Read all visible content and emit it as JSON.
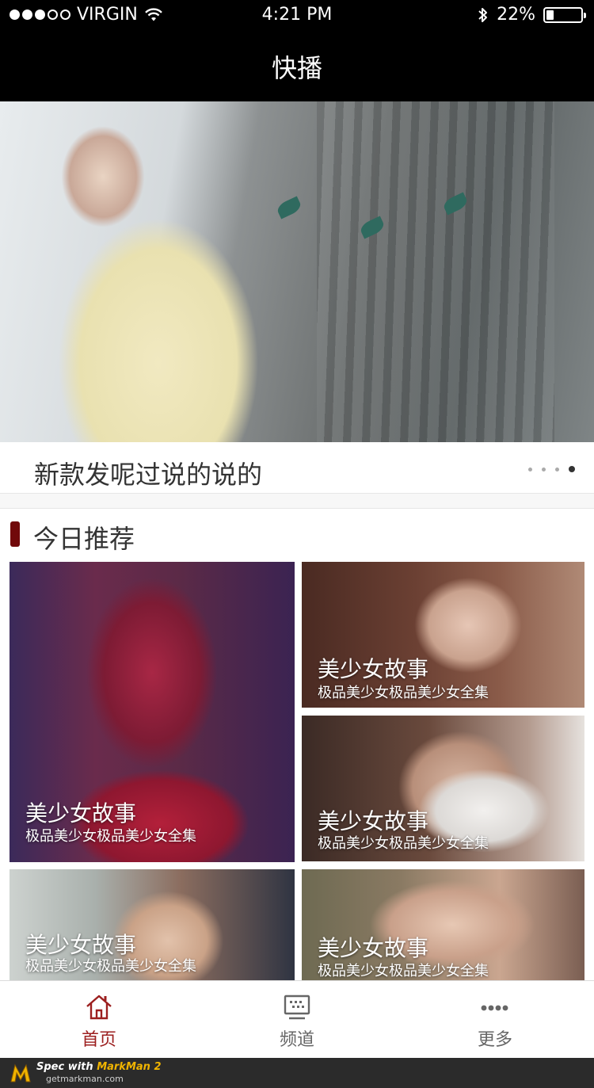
{
  "status_bar": {
    "carrier": "VIRGIN",
    "time": "4:21 PM",
    "battery_text": "22%",
    "battery_level": 0.22
  },
  "nav": {
    "title": "快播"
  },
  "banner": {
    "caption": "新款发呢过说的说的",
    "page_count": 4,
    "active_page": 4
  },
  "colors": {
    "divider_bg": "#f7f7f7",
    "section_accent": "#71090a",
    "tab_active": "#9c1f1f"
  },
  "section": {
    "title": "今日推荐"
  },
  "cards": [
    {
      "title": "美少女故事",
      "subtitle": "极品美少女极品美少女全集"
    },
    {
      "title": "美少女故事",
      "subtitle": "极品美少女极品美少女全集"
    },
    {
      "title": "美少女故事",
      "subtitle": "极品美少女极品美少女全集"
    },
    {
      "title": "美少女故事",
      "subtitle": "极品美少女极品美少女全集"
    },
    {
      "title": "美少女故事",
      "subtitle": "极品美少女极品美少女全集"
    }
  ],
  "tabs": [
    {
      "label": "首页",
      "icon": "home-icon",
      "active": true
    },
    {
      "label": "频道",
      "icon": "channel-icon",
      "active": false
    },
    {
      "label": "更多",
      "icon": "more-icon",
      "active": false
    }
  ],
  "footer": {
    "brand_prefix": "Spec with ",
    "brand_name": "MarkMan 2",
    "url": "getmarkman.com"
  }
}
